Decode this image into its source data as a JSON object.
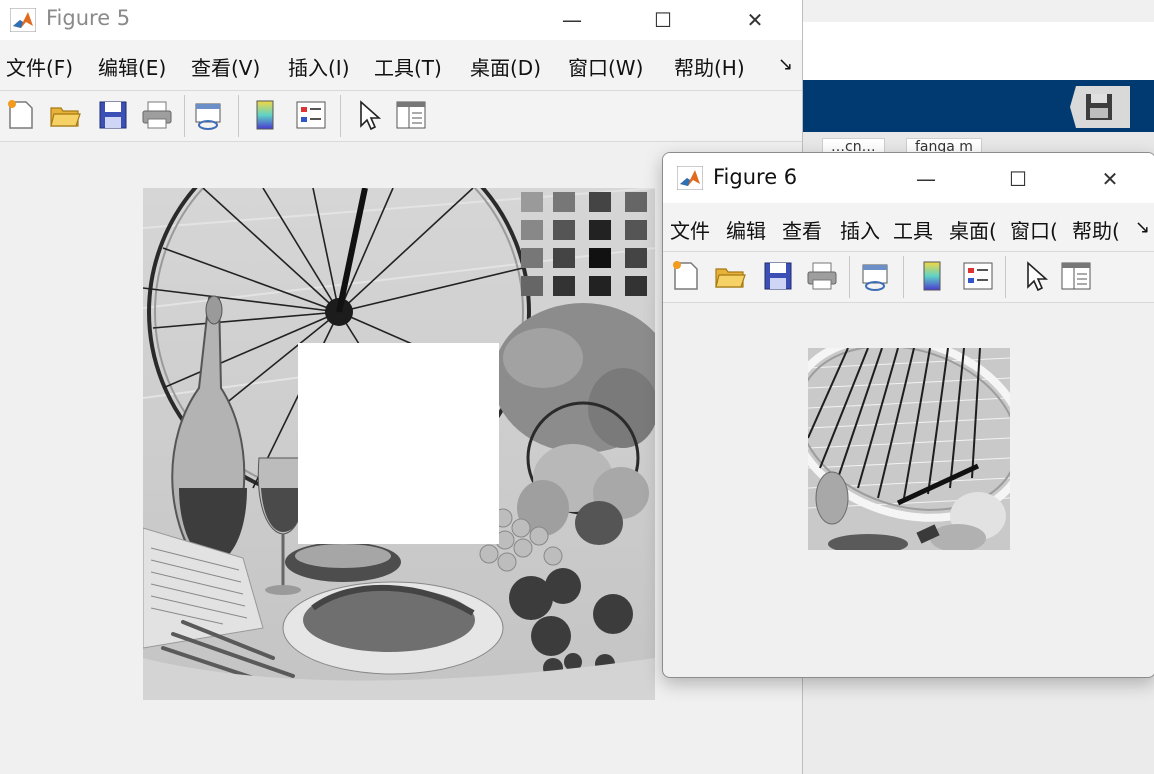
{
  "background_app": {
    "tabs": [
      "…cn…",
      "fanga m"
    ]
  },
  "figure5": {
    "title": "Figure 5",
    "menu": [
      "文件(F)",
      "编辑(E)",
      "查看(V)",
      "插入(I)",
      "工具(T)",
      "桌面(D)",
      "窗口(W)",
      "帮助(H)"
    ],
    "menu_overflow": "↘",
    "toolbar": [
      "new-figure",
      "open-file",
      "save",
      "print",
      "link-plot",
      "colorbar",
      "legend",
      "select-pointer",
      "property-inspector"
    ],
    "window_controls": {
      "minimize": "—",
      "maximize": "☐",
      "close": "✕"
    }
  },
  "figure6": {
    "title": "Figure 6",
    "menu": [
      "文件",
      "编辑",
      "查看",
      "插入",
      "工具",
      "桌面(",
      "窗口(",
      "帮助("
    ],
    "menu_overflow": "↘",
    "toolbar": [
      "new-figure",
      "open-file",
      "save",
      "print",
      "link-plot",
      "colorbar",
      "legend",
      "select-pointer",
      "property-inspector"
    ],
    "window_controls": {
      "minimize": "—",
      "maximize": "☐",
      "close": "✕"
    }
  },
  "colors": {
    "matlab_blue": "#003a70",
    "window_bg": "#f0f0f0",
    "image_gray": "#bdbdbd"
  }
}
